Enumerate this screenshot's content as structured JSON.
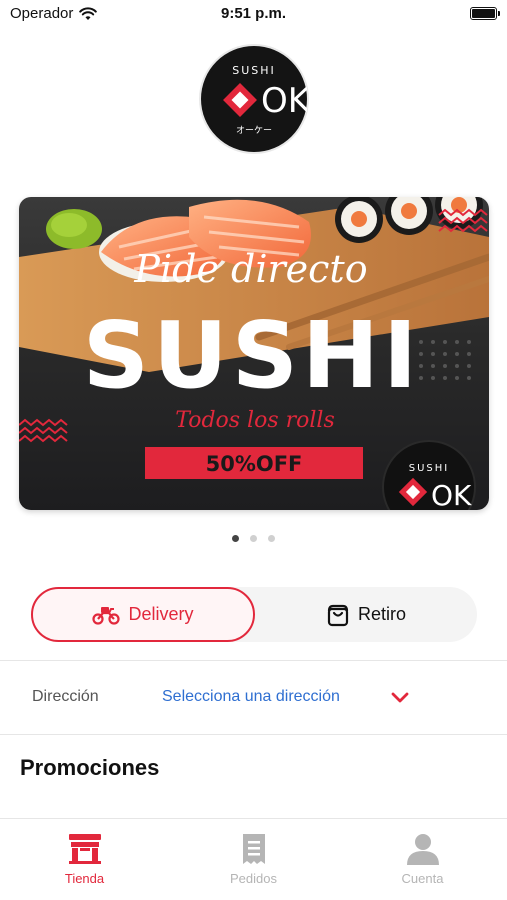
{
  "status_bar": {
    "carrier": "Operador",
    "time": "9:51 p.m.",
    "icons": [
      "wifi-icon",
      "battery-icon"
    ]
  },
  "brand": {
    "logo_top": "SUSHI",
    "logo_main": "OK",
    "logo_bottom": "オーケー",
    "accent_color": "#e2283c"
  },
  "banner": {
    "script_line": "Pide directo",
    "headline": "SUSHI",
    "subline": "Todos los rolls",
    "badge": "50%OFF",
    "slides": 3,
    "active_slide": 1
  },
  "delivery_toggle": {
    "options": [
      {
        "label": "Delivery",
        "icon": "motorcycle-icon",
        "selected": true
      },
      {
        "label": "Retiro",
        "icon": "shopping-bag-icon",
        "selected": false
      }
    ]
  },
  "address": {
    "label": "Dirección",
    "value": "Selecciona una dirección",
    "icon": "chevron-down-icon"
  },
  "sections": {
    "promotions_title": "Promociones"
  },
  "tab_bar": {
    "tabs": [
      {
        "label": "Tienda",
        "icon": "store-icon",
        "active": true
      },
      {
        "label": "Pedidos",
        "icon": "receipt-icon",
        "active": false
      },
      {
        "label": "Cuenta",
        "icon": "user-icon",
        "active": false
      }
    ]
  }
}
